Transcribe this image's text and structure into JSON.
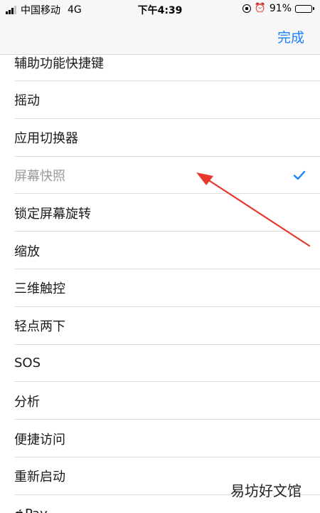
{
  "status_bar": {
    "carrier": "中国移动",
    "network": "4G",
    "time": "下午4:39",
    "battery_percent": "91%",
    "battery_level": 0.91,
    "icons": [
      "signal-icon",
      "rotation-lock-icon",
      "alarm-icon",
      "battery-icon"
    ]
  },
  "nav": {
    "done_label": "完成"
  },
  "list": {
    "items": [
      {
        "label": "辅助功能快捷键",
        "selected": false
      },
      {
        "label": "摇动",
        "selected": false
      },
      {
        "label": "应用切换器",
        "selected": false
      },
      {
        "label": "屏幕快照",
        "selected": true
      },
      {
        "label": "锁定屏幕旋转",
        "selected": false
      },
      {
        "label": "缩放",
        "selected": false
      },
      {
        "label": "三维触控",
        "selected": false
      },
      {
        "label": "轻点两下",
        "selected": false
      },
      {
        "label": "SOS",
        "selected": false
      },
      {
        "label": "分析",
        "selected": false
      },
      {
        "label": "便捷访问",
        "selected": false
      },
      {
        "label": "重新启动",
        "selected": false
      },
      {
        "label": "Pay",
        "selected": false
      }
    ]
  },
  "colors": {
    "accent": "#1a82fb",
    "annotation": "#e8392f"
  },
  "watermark": "易坊好文馆"
}
